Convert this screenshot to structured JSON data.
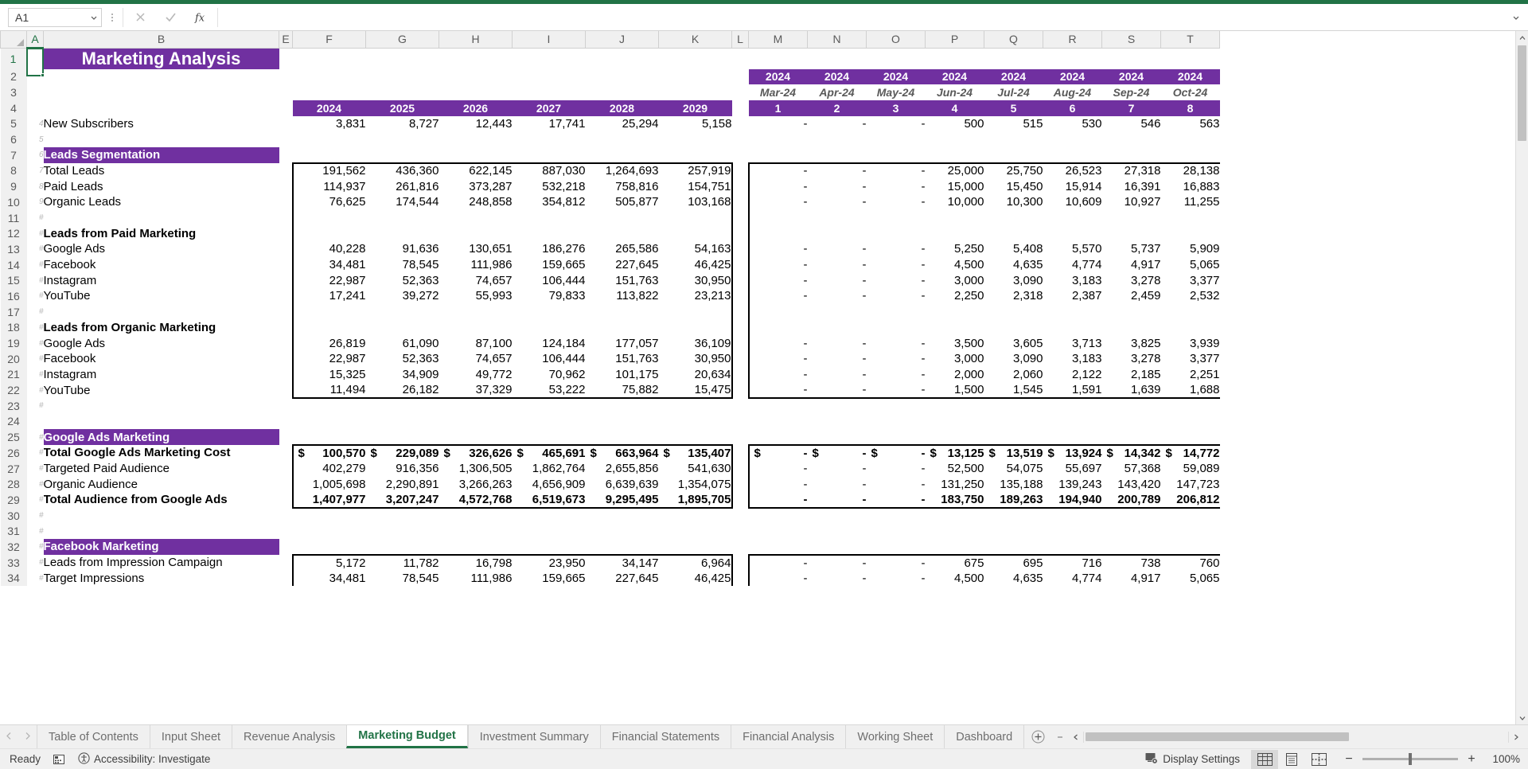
{
  "namebox": {
    "value": "A1"
  },
  "formula": {
    "value": "",
    "placeholder": ""
  },
  "icons": {
    "cancel": "cancel-icon",
    "confirm": "confirm-icon",
    "fx": "fx-icon"
  },
  "columns": [
    "A",
    "B",
    "E",
    "F",
    "G",
    "H",
    "I",
    "J",
    "K",
    "L",
    "M",
    "N",
    "O",
    "P",
    "Q",
    "R",
    "S",
    "T"
  ],
  "title": "Marketing Analysis",
  "year_headers": [
    "2024",
    "2025",
    "2026",
    "2027",
    "2028",
    "2029"
  ],
  "month_year_headers": [
    "2024",
    "2024",
    "2024",
    "2024",
    "2024",
    "2024",
    "2024",
    "2024"
  ],
  "month_labels": [
    "Mar-24",
    "Apr-24",
    "May-24",
    "Jun-24",
    "Jul-24",
    "Aug-24",
    "Sep-24",
    "Oct-24"
  ],
  "month_numbers": [
    "1",
    "2",
    "3",
    "4",
    "5",
    "6",
    "7",
    "8"
  ],
  "rows": [
    {
      "n": "1",
      "a": "",
      "label": "Marketing Analysis",
      "style": "title"
    },
    {
      "n": "2",
      "a": "",
      "label": "",
      "style": "blank"
    },
    {
      "n": "3",
      "a": "",
      "label": "",
      "style": "yearhdr"
    },
    {
      "n": "4",
      "a": "",
      "label": "",
      "style": "monthhdr"
    },
    {
      "n": "5",
      "a": "4",
      "label": "New Subscribers",
      "style": "data",
      "years": [
        "3,831",
        "8,727",
        "12,443",
        "17,741",
        "25,294",
        "5,158"
      ],
      "months": [
        "-",
        "-",
        "-",
        "500",
        "515",
        "530",
        "546",
        "563"
      ]
    },
    {
      "n": "6",
      "a": "5",
      "label": "",
      "style": "blank"
    },
    {
      "n": "7",
      "a": "6",
      "label": "Leads Segmentation",
      "style": "section"
    },
    {
      "n": "8",
      "a": "7",
      "label": "Total Leads",
      "style": "data",
      "box": "top",
      "years": [
        "191,562",
        "436,360",
        "622,145",
        "887,030",
        "1,264,693",
        "257,919"
      ],
      "months": [
        "-",
        "-",
        "-",
        "25,000",
        "25,750",
        "26,523",
        "27,318",
        "28,138"
      ]
    },
    {
      "n": "9",
      "a": "8",
      "label": "Paid Leads",
      "style": "data",
      "box": "mid",
      "years": [
        "114,937",
        "261,816",
        "373,287",
        "532,218",
        "758,816",
        "154,751"
      ],
      "months": [
        "-",
        "-",
        "-",
        "15,000",
        "15,450",
        "15,914",
        "16,391",
        "16,883"
      ]
    },
    {
      "n": "10",
      "a": "9",
      "label": "Organic Leads",
      "style": "data",
      "box": "mid",
      "years": [
        "76,625",
        "174,544",
        "248,858",
        "354,812",
        "505,877",
        "103,168"
      ],
      "months": [
        "-",
        "-",
        "-",
        "10,000",
        "10,300",
        "10,609",
        "10,927",
        "11,255"
      ]
    },
    {
      "n": "11",
      "a": "#",
      "label": "",
      "style": "data",
      "box": "mid",
      "years": [
        "",
        "",
        "",
        "",
        "",
        ""
      ],
      "months": [
        "",
        "",
        "",
        "",
        "",
        "",
        "",
        ""
      ]
    },
    {
      "n": "12",
      "a": "#",
      "label": "Leads from Paid Marketing",
      "style": "databold",
      "box": "mid",
      "years": [
        "",
        "",
        "",
        "",
        "",
        ""
      ],
      "months": [
        "",
        "",
        "",
        "",
        "",
        "",
        "",
        ""
      ]
    },
    {
      "n": "13",
      "a": "#",
      "label": "Google Ads",
      "style": "data",
      "box": "mid",
      "years": [
        "40,228",
        "91,636",
        "130,651",
        "186,276",
        "265,586",
        "54,163"
      ],
      "months": [
        "-",
        "-",
        "-",
        "5,250",
        "5,408",
        "5,570",
        "5,737",
        "5,909"
      ]
    },
    {
      "n": "14",
      "a": "#",
      "label": "Facebook",
      "style": "data",
      "box": "mid",
      "years": [
        "34,481",
        "78,545",
        "111,986",
        "159,665",
        "227,645",
        "46,425"
      ],
      "months": [
        "-",
        "-",
        "-",
        "4,500",
        "4,635",
        "4,774",
        "4,917",
        "5,065"
      ]
    },
    {
      "n": "15",
      "a": "#",
      "label": "Instagram",
      "style": "data",
      "box": "mid",
      "years": [
        "22,987",
        "52,363",
        "74,657",
        "106,444",
        "151,763",
        "30,950"
      ],
      "months": [
        "-",
        "-",
        "-",
        "3,000",
        "3,090",
        "3,183",
        "3,278",
        "3,377"
      ]
    },
    {
      "n": "16",
      "a": "#",
      "label": "YouTube",
      "style": "data",
      "box": "mid",
      "years": [
        "17,241",
        "39,272",
        "55,993",
        "79,833",
        "113,822",
        "23,213"
      ],
      "months": [
        "-",
        "-",
        "-",
        "2,250",
        "2,318",
        "2,387",
        "2,459",
        "2,532"
      ]
    },
    {
      "n": "17",
      "a": "#",
      "label": "",
      "style": "data",
      "box": "mid",
      "years": [
        "",
        "",
        "",
        "",
        "",
        ""
      ],
      "months": [
        "",
        "",
        "",
        "",
        "",
        "",
        "",
        ""
      ]
    },
    {
      "n": "18",
      "a": "#",
      "label": "Leads from Organic Marketing",
      "style": "databold",
      "box": "mid",
      "years": [
        "",
        "",
        "",
        "",
        "",
        ""
      ],
      "months": [
        "",
        "",
        "",
        "",
        "",
        "",
        "",
        ""
      ]
    },
    {
      "n": "19",
      "a": "#",
      "label": "Google Ads",
      "style": "data",
      "box": "mid",
      "years": [
        "26,819",
        "61,090",
        "87,100",
        "124,184",
        "177,057",
        "36,109"
      ],
      "months": [
        "-",
        "-",
        "-",
        "3,500",
        "3,605",
        "3,713",
        "3,825",
        "3,939"
      ]
    },
    {
      "n": "20",
      "a": "#",
      "label": "Facebook",
      "style": "data",
      "box": "mid",
      "years": [
        "22,987",
        "52,363",
        "74,657",
        "106,444",
        "151,763",
        "30,950"
      ],
      "months": [
        "-",
        "-",
        "-",
        "3,000",
        "3,090",
        "3,183",
        "3,278",
        "3,377"
      ]
    },
    {
      "n": "21",
      "a": "#",
      "label": "Instagram",
      "style": "data",
      "box": "mid",
      "years": [
        "15,325",
        "34,909",
        "49,772",
        "70,962",
        "101,175",
        "20,634"
      ],
      "months": [
        "-",
        "-",
        "-",
        "2,000",
        "2,060",
        "2,122",
        "2,185",
        "2,251"
      ]
    },
    {
      "n": "22",
      "a": "#",
      "label": "YouTube",
      "style": "data",
      "box": "bottom",
      "years": [
        "11,494",
        "26,182",
        "37,329",
        "53,222",
        "75,882",
        "15,475"
      ],
      "months": [
        "-",
        "-",
        "-",
        "1,500",
        "1,545",
        "1,591",
        "1,639",
        "1,688"
      ]
    },
    {
      "n": "23",
      "a": "#",
      "label": "",
      "style": "blank"
    },
    {
      "n": "24",
      "a": "",
      "label": "",
      "style": "blank"
    },
    {
      "n": "25",
      "a": "#",
      "label": "Google Ads Marketing",
      "style": "section"
    },
    {
      "n": "26",
      "a": "#",
      "label": "Total Google Ads Marketing Cost",
      "style": "databold",
      "box": "top",
      "currency": true,
      "years": [
        "100,570",
        "229,089",
        "326,626",
        "465,691",
        "663,964",
        "135,407"
      ],
      "months": [
        "-",
        "-",
        "-",
        "13,125",
        "13,519",
        "13,924",
        "14,342",
        "14,772"
      ]
    },
    {
      "n": "27",
      "a": "#",
      "label": "Targeted Paid Audience",
      "style": "data",
      "box": "mid",
      "years": [
        "402,279",
        "916,356",
        "1,306,505",
        "1,862,764",
        "2,655,856",
        "541,630"
      ],
      "months": [
        "-",
        "-",
        "-",
        "52,500",
        "54,075",
        "55,697",
        "57,368",
        "59,089"
      ]
    },
    {
      "n": "28",
      "a": "#",
      "label": "Organic Audience",
      "style": "data",
      "box": "mid",
      "years": [
        "1,005,698",
        "2,290,891",
        "3,266,263",
        "4,656,909",
        "6,639,639",
        "1,354,075"
      ],
      "months": [
        "-",
        "-",
        "-",
        "131,250",
        "135,188",
        "139,243",
        "143,420",
        "147,723"
      ]
    },
    {
      "n": "29",
      "a": "#",
      "label": "Total Audience from Google Ads",
      "style": "databold",
      "box": "bottom",
      "years": [
        "1,407,977",
        "3,207,247",
        "4,572,768",
        "6,519,673",
        "9,295,495",
        "1,895,705"
      ],
      "months": [
        "-",
        "-",
        "-",
        "183,750",
        "189,263",
        "194,940",
        "200,789",
        "206,812"
      ]
    },
    {
      "n": "30",
      "a": "#",
      "label": "",
      "style": "blank"
    },
    {
      "n": "31",
      "a": "#",
      "label": "",
      "style": "blank"
    },
    {
      "n": "32",
      "a": "#",
      "label": "Facebook Marketing",
      "style": "section"
    },
    {
      "n": "33",
      "a": "#",
      "label": "Leads from Impression Campaign",
      "style": "data",
      "box": "top",
      "years": [
        "5,172",
        "11,782",
        "16,798",
        "23,950",
        "34,147",
        "6,964"
      ],
      "months": [
        "-",
        "-",
        "-",
        "675",
        "695",
        "716",
        "738",
        "760"
      ]
    },
    {
      "n": "34",
      "a": "#",
      "label": "Target Impressions",
      "style": "data",
      "box": "mid",
      "years": [
        "34,481",
        "78,545",
        "111,986",
        "159,665",
        "227,645",
        "46,425"
      ],
      "months": [
        "-",
        "-",
        "-",
        "4,500",
        "4,635",
        "4,774",
        "4,917",
        "5,065"
      ]
    }
  ],
  "tabs": [
    {
      "label": "Table of Contents",
      "active": false
    },
    {
      "label": "Input Sheet",
      "active": false
    },
    {
      "label": "Revenue Analysis",
      "active": false
    },
    {
      "label": "Marketing Budget",
      "active": true
    },
    {
      "label": "Investment Summary",
      "active": false
    },
    {
      "label": "Financial Statements",
      "active": false
    },
    {
      "label": "Financial Analysis",
      "active": false
    },
    {
      "label": "Working Sheet",
      "active": false
    },
    {
      "label": "Dashboard",
      "active": false
    }
  ],
  "statusbar": {
    "ready": "Ready",
    "accessibility": "Accessibility: Investigate",
    "display_settings": "Display Settings",
    "zoom": "100%"
  },
  "colors": {
    "accent_purple": "#7030a0",
    "excel_green": "#217346",
    "header_gray": "#f0f0f0"
  }
}
